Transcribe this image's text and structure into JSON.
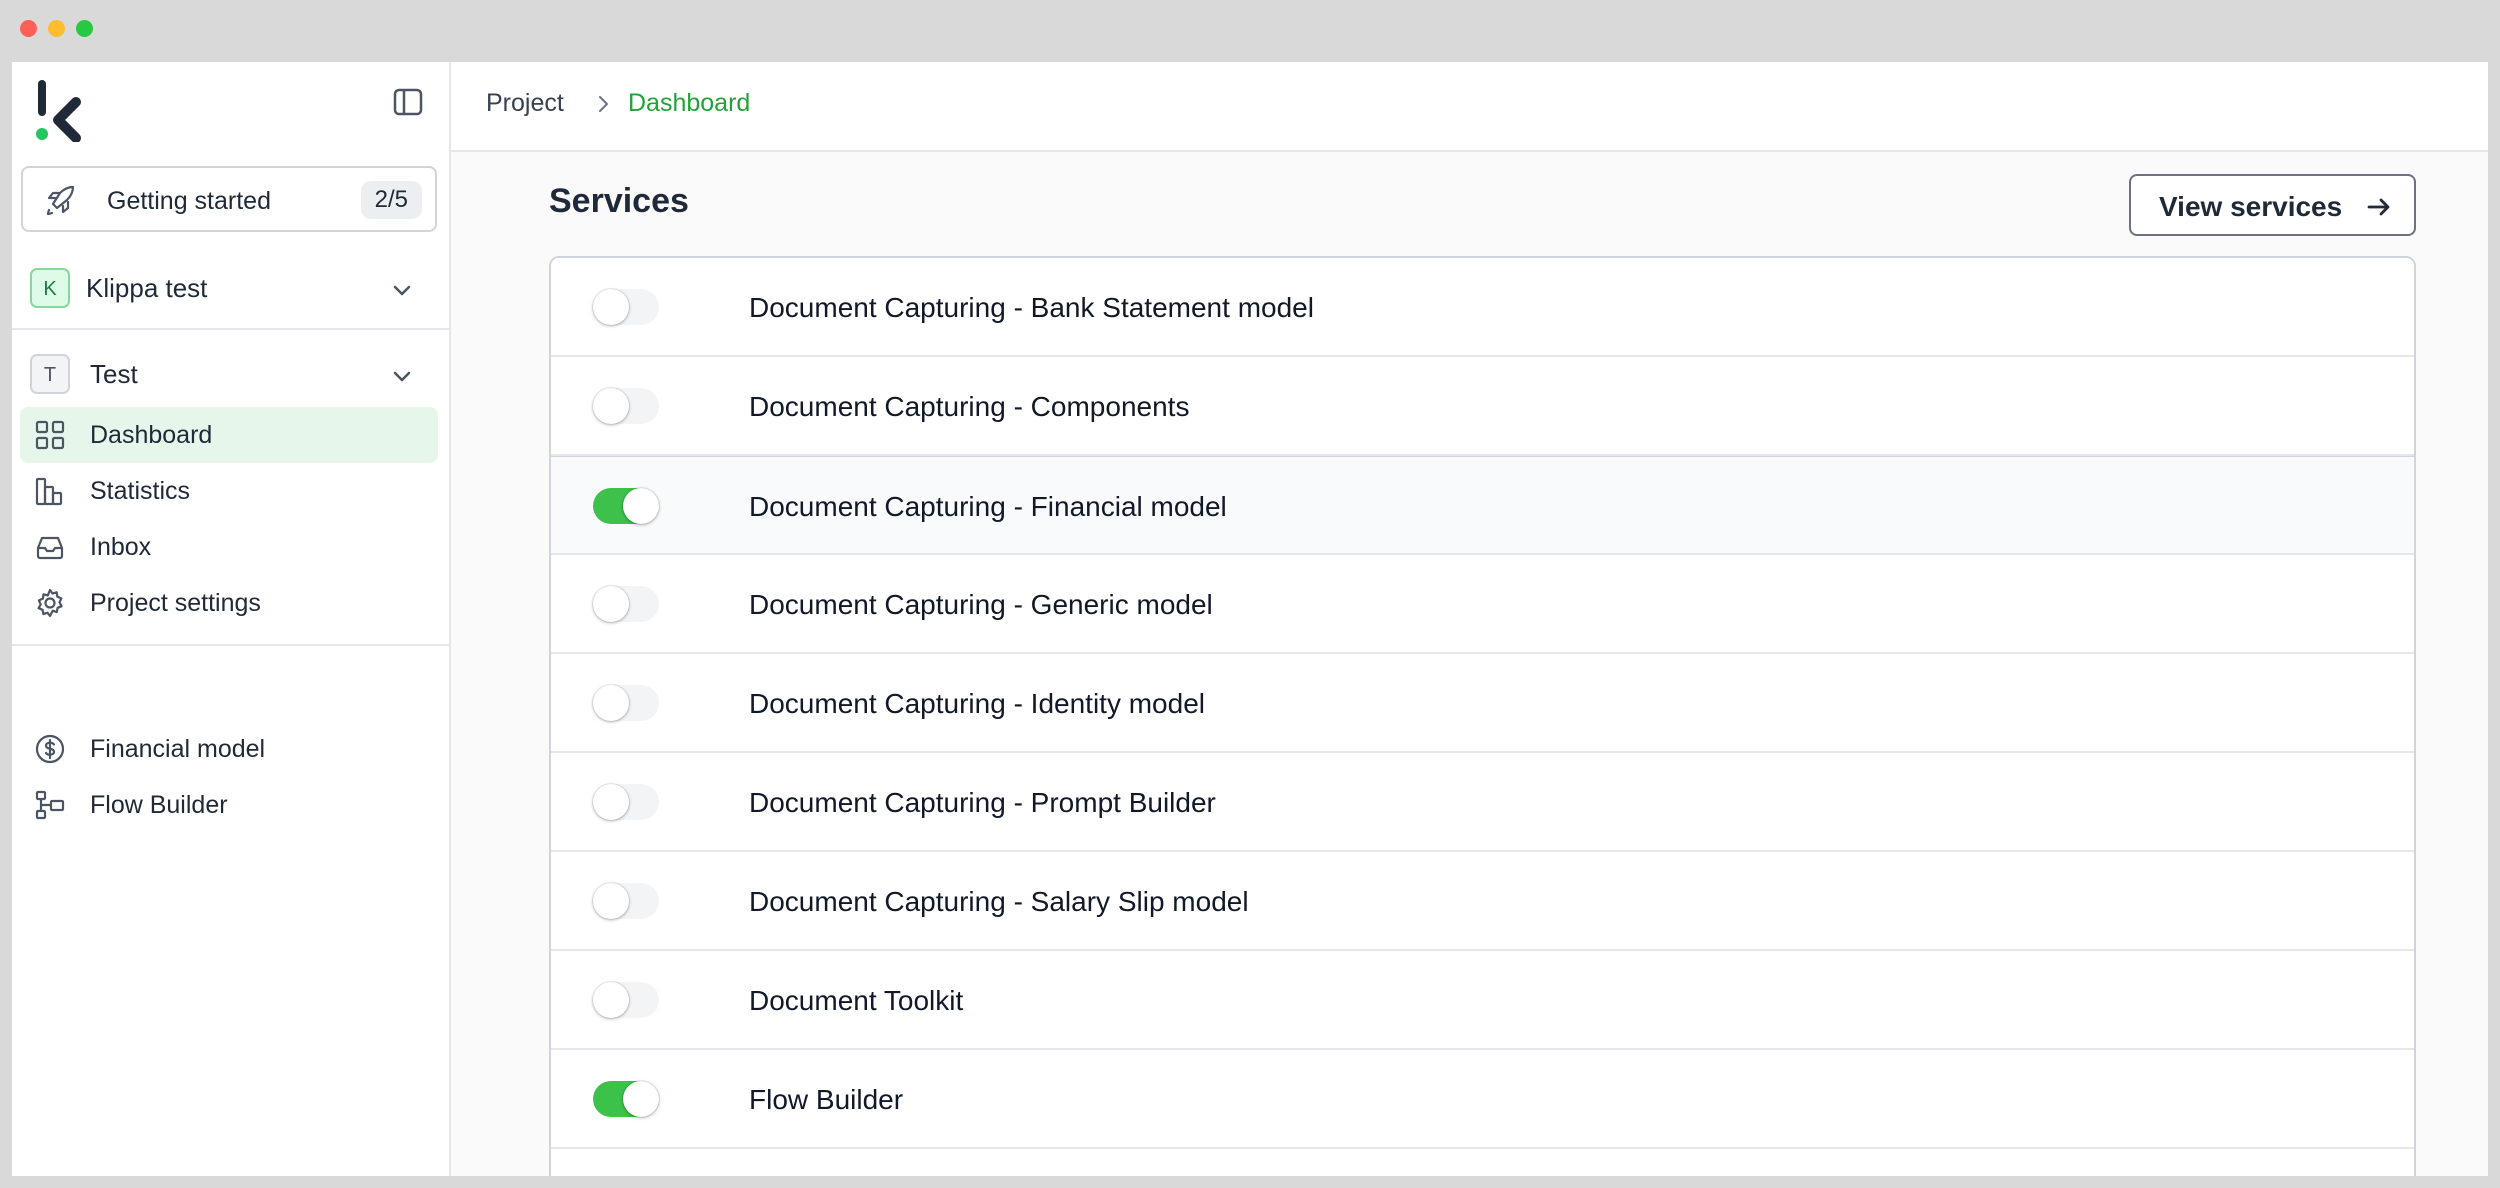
{
  "window": {
    "traffic_lights": {
      "close": "#ff5f57",
      "minimize": "#febc2e",
      "maximize": "#28c840"
    }
  },
  "brand": {
    "accent": "#22a33a",
    "logo_dot": "#22c55e"
  },
  "sidebar": {
    "getting_started": {
      "label": "Getting started",
      "progress": "2/5"
    },
    "organization": {
      "initial": "K",
      "name": "Klippa test"
    },
    "project": {
      "initial": "T",
      "name": "Test"
    },
    "nav": [
      {
        "label": "Dashboard",
        "icon": "grid-icon",
        "active": true
      },
      {
        "label": "Statistics",
        "icon": "bar-chart-icon",
        "active": false
      },
      {
        "label": "Inbox",
        "icon": "inbox-icon",
        "active": false
      },
      {
        "label": "Project settings",
        "icon": "gear-icon",
        "active": false
      }
    ],
    "extras": [
      {
        "label": "Financial model",
        "icon": "dollar-circle-icon"
      },
      {
        "label": "Flow Builder",
        "icon": "flow-icon"
      }
    ]
  },
  "breadcrumb": {
    "parent": "Project",
    "current": "Dashboard"
  },
  "services": {
    "title": "Services",
    "view_button": "View services",
    "items": [
      {
        "name": "Document Capturing - Bank Statement model",
        "enabled": false
      },
      {
        "name": "Document Capturing - Components",
        "enabled": false
      },
      {
        "name": "Document Capturing - Financial model",
        "enabled": true
      },
      {
        "name": "Document Capturing - Generic model",
        "enabled": false
      },
      {
        "name": "Document Capturing - Identity model",
        "enabled": false
      },
      {
        "name": "Document Capturing - Prompt Builder",
        "enabled": false
      },
      {
        "name": "Document Capturing - Salary Slip model",
        "enabled": false
      },
      {
        "name": "Document Toolkit",
        "enabled": false
      },
      {
        "name": "Flow Builder",
        "enabled": true
      }
    ]
  }
}
